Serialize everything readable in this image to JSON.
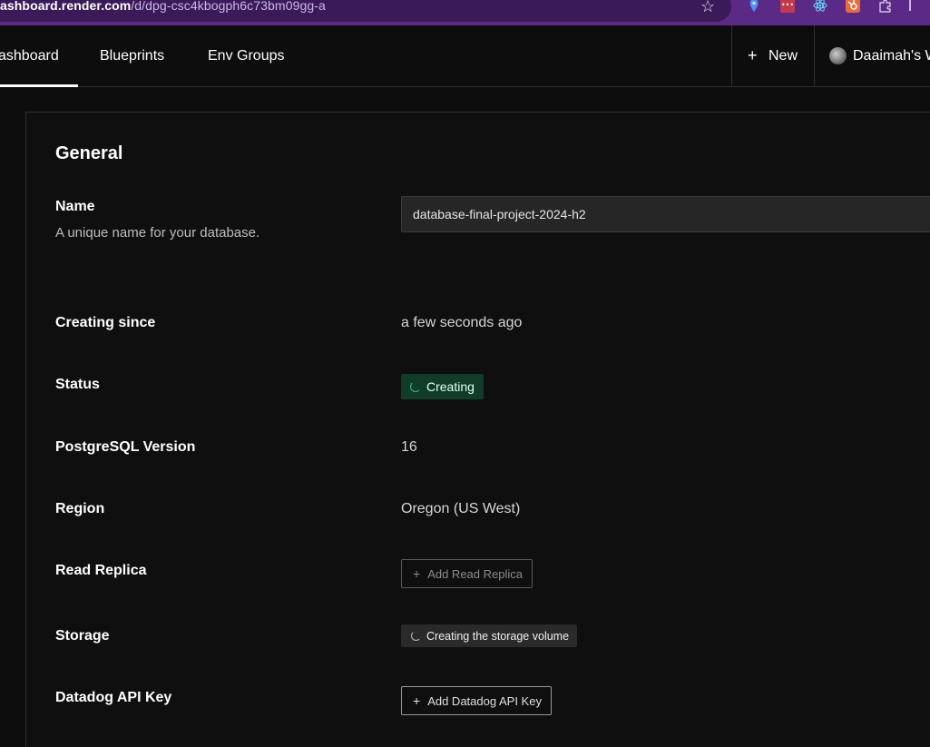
{
  "browser": {
    "url_host": "ashboard.render.com",
    "url_path": "/d/dpg-csc4kbogph6c73bm09gg-a",
    "bookmark_icon": "star-icon",
    "extensions": [
      "location-pin-icon",
      "password-manager-icon",
      "react-devtools-icon",
      "hubspot-icon",
      "puzzle-icon"
    ]
  },
  "nav": {
    "tabs": [
      {
        "label": "ashboard",
        "active": true
      },
      {
        "label": "Blueprints",
        "active": false
      },
      {
        "label": "Env Groups",
        "active": false
      }
    ],
    "new_label": "New",
    "new_icon": "plus-icon",
    "workspace_name": "Daaimah's W"
  },
  "general": {
    "title": "General",
    "name": {
      "label": "Name",
      "help": "A unique name for your database.",
      "value": "database-final-project-2024-h2"
    },
    "creating_since": {
      "label": "Creating since",
      "value": "a few seconds ago"
    },
    "status": {
      "label": "Status",
      "value": "Creating",
      "color": "#0f3d2a"
    },
    "postgres_version": {
      "label": "PostgreSQL Version",
      "value": "16"
    },
    "region": {
      "label": "Region",
      "value": "Oregon (US West)"
    },
    "read_replica": {
      "label": "Read Replica",
      "button": "Add Read Replica"
    },
    "storage": {
      "label": "Storage",
      "value": "Creating the storage volume"
    },
    "datadog": {
      "label": "Datadog API Key",
      "button": "Add Datadog API Key"
    }
  }
}
